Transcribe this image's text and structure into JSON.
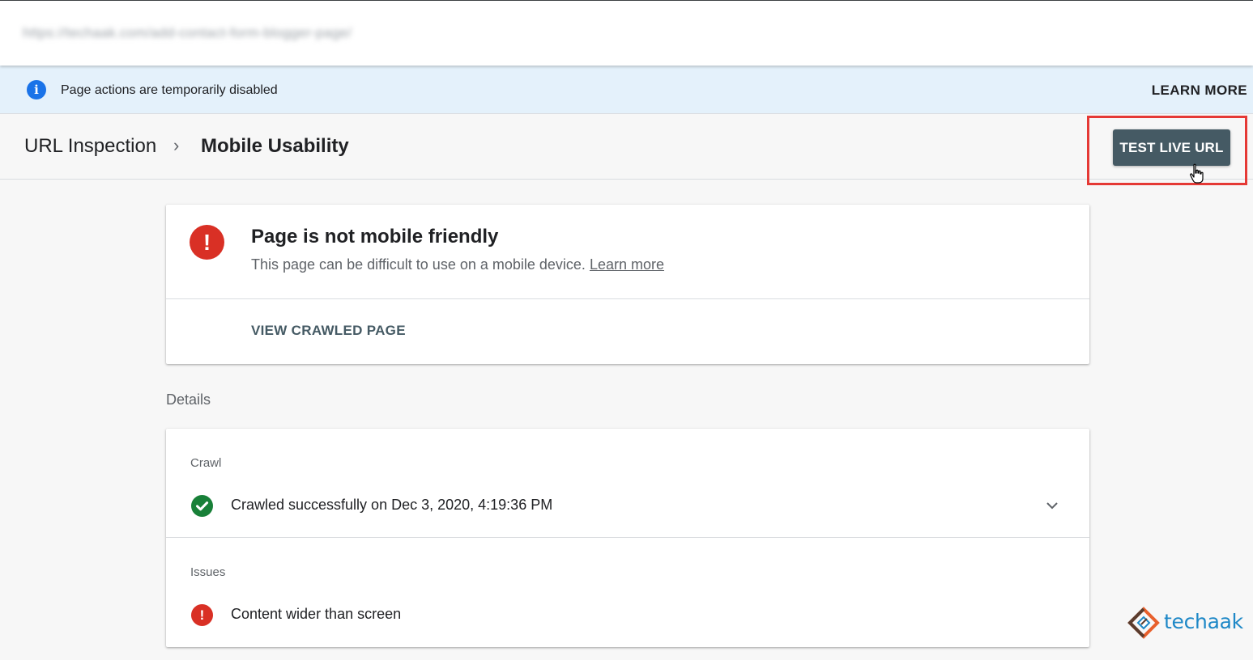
{
  "url_bar": {
    "url": "https://techaak.com/add-contact-form-blogger-page/"
  },
  "banner": {
    "icon": "info-icon",
    "message": "Page actions are temporarily disabled",
    "action_label": "LEARN MORE"
  },
  "header": {
    "breadcrumb_root": "URL Inspection",
    "separator": "›",
    "breadcrumb_current": "Mobile Usability",
    "test_live_url_label": "TEST LIVE URL"
  },
  "status_card": {
    "icon": "error-icon",
    "title": "Page is not mobile friendly",
    "subtitle": "This page can be difficult to use on a mobile device.",
    "learn_more_link": "Learn more",
    "view_crawled_label": "VIEW CRAWLED PAGE"
  },
  "details": {
    "section_title": "Details",
    "crawl": {
      "label": "Crawl",
      "icon": "check-circle-icon",
      "status_text": "Crawled successfully on Dec 3, 2020, 4:19:36 PM"
    },
    "issues": {
      "label": "Issues",
      "icon": "error-icon",
      "items": [
        "Content wider than screen"
      ]
    }
  },
  "watermark": {
    "brand": "techaak"
  },
  "colors": {
    "banner_bg": "#e4f1fb",
    "info_blue": "#1a73e8",
    "error_red": "#d93025",
    "success_green": "#188038",
    "button_dark": "#455a64",
    "highlight_red": "#e53935",
    "brand_blue": "#1e88c7",
    "brand_orange": "#e8602c"
  }
}
